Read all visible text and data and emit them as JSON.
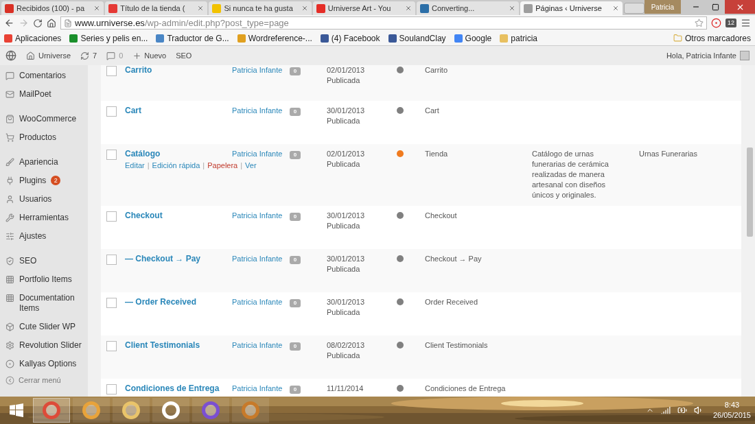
{
  "browser": {
    "tabs": [
      {
        "title": "Recibidos (100) - pa",
        "selected": false,
        "color": "#d93025"
      },
      {
        "title": "Título de la tienda (",
        "selected": false,
        "color": "#e53935"
      },
      {
        "title": "Si nunca te ha gusta",
        "selected": false,
        "color": "#f2c200"
      },
      {
        "title": "Urniverse Art - You",
        "selected": false,
        "color": "#e52d27"
      },
      {
        "title": "Converting...",
        "selected": false,
        "color": "#2c6fa8"
      },
      {
        "title": "Páginas ‹ Urniverse",
        "selected": true,
        "color": "#9e9e9e"
      }
    ],
    "profile": "Patricia",
    "url_host": "www.urniverse.es",
    "url_path": "/wp-admin/edit.php?post_type=page",
    "extension_badge": "12",
    "bookmarks": [
      {
        "label": "Aplicaciones",
        "color": "#e94235"
      },
      {
        "label": "Series y pelis en...",
        "color": "#1a8f2b"
      },
      {
        "label": "Traductor de G...",
        "color": "#4a86c5"
      },
      {
        "label": "Wordreference-...",
        "color": "#e0a020"
      },
      {
        "label": "(4) Facebook",
        "color": "#3b5998"
      },
      {
        "label": "SoulandClay",
        "color": "#3b5998"
      },
      {
        "label": "Google",
        "color": "#4285f4"
      },
      {
        "label": "patricia",
        "color": "#e8c060"
      }
    ],
    "other_bookmarks": "Otros marcadores"
  },
  "admin_bar": {
    "site": "Urniverse",
    "updates": "7",
    "comments": "0",
    "new": "Nuevo",
    "seo": "SEO",
    "greeting": "Hola, Patricia Infante"
  },
  "sidebar": {
    "groups": [
      {
        "items": [
          {
            "label": "Comentarios"
          },
          {
            "label": "MailPoet"
          }
        ]
      },
      {
        "items": [
          {
            "label": "WooCommerce"
          },
          {
            "label": "Productos"
          }
        ]
      },
      {
        "items": [
          {
            "label": "Apariencia"
          },
          {
            "label": "Plugins",
            "badge": "2"
          },
          {
            "label": "Usuarios"
          },
          {
            "label": "Herramientas"
          },
          {
            "label": "Ajustes"
          }
        ]
      },
      {
        "items": [
          {
            "label": "SEO"
          },
          {
            "label": "Portfolio Items"
          },
          {
            "label": "Documentation Items"
          },
          {
            "label": "Cute Slider WP"
          },
          {
            "label": "Revolution Slider"
          },
          {
            "label": "Kallyas Options"
          }
        ]
      }
    ],
    "collapse": "Cerrar menú"
  },
  "table": {
    "action_separator": "|",
    "rows": [
      {
        "checked": false,
        "title": "Carrito",
        "author": "Patricia Infante",
        "comments": "0",
        "date": "02/01/2013",
        "status": "Publicada",
        "color": "#808080",
        "column_6": "Carrito"
      },
      {
        "checked": false,
        "title": "Cart",
        "author": "Patricia Infante",
        "comments": "0",
        "date": "30/01/2013",
        "status": "Publicada",
        "color": "#808080",
        "column_6": "Cart"
      },
      {
        "checked": false,
        "title": "Catálogo",
        "author": "Patricia Infante",
        "comments": "0",
        "date": "02/01/2013",
        "status": "Publicada",
        "color": "#f07b1f",
        "column_6": "Tienda",
        "column_7": "Catálogo de urnas funerarias de cerámica realizadas de manera artesanal con diseños únicos y originales.",
        "column_8": "Urnas Funerarias",
        "actions": [
          {
            "label": "Editar",
            "kind": "link"
          },
          {
            "label": "Edición rápida",
            "kind": "link"
          },
          {
            "label": "Papelera",
            "kind": "delete"
          },
          {
            "label": "Ver",
            "kind": "link"
          }
        ]
      },
      {
        "checked": false,
        "title": "Checkout",
        "author": "Patricia Infante",
        "comments": "0",
        "date": "30/01/2013",
        "status": "Publicada",
        "color": "#808080",
        "column_6": "Checkout"
      },
      {
        "checked": false,
        "title": "— Checkout → Pay",
        "author": "Patricia Infante",
        "comments": "0",
        "date": "30/01/2013",
        "status": "Publicada",
        "color": "#808080",
        "column_6": "Checkout → Pay"
      },
      {
        "checked": false,
        "title": "— Order Received",
        "author": "Patricia Infante",
        "comments": "0",
        "date": "30/01/2013",
        "status": "Publicada",
        "color": "#808080",
        "column_6": "Order Received"
      },
      {
        "checked": false,
        "title": "Client Testimonials",
        "author": "Patricia Infante",
        "comments": "0",
        "date": "08/02/2013",
        "status": "Publicada",
        "color": "#808080",
        "column_6": "Client Testimonials"
      },
      {
        "checked": false,
        "title": "Condiciones de Entrega",
        "author": "Patricia Infante",
        "comments": "0",
        "date": "11/11/2014",
        "color": "#808080",
        "column_6": "Condiciones de Entrega"
      }
    ]
  },
  "taskbar": {
    "apps": [
      {
        "selected": true
      },
      {
        "selected": false
      },
      {
        "selected": false
      },
      {
        "selected": false
      },
      {
        "selected": false
      },
      {
        "selected": false
      }
    ],
    "time": "8:43",
    "date": "26/05/2015"
  }
}
